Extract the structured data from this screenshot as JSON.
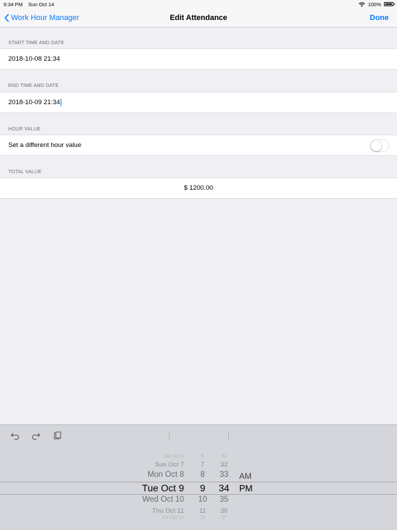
{
  "status_bar": {
    "time": "9:34 PM",
    "date": "Sun Oct 14",
    "battery": "100%"
  },
  "nav": {
    "back_label": "Work Hour Manager",
    "title": "Edit Attendance",
    "done_label": "Done"
  },
  "sections": {
    "start": {
      "header": "START TIME AND DATE",
      "value": "2018-10-08 21:34"
    },
    "end": {
      "header": "END TIME AND DATE",
      "value": "2018-10-09 21:34"
    },
    "hour": {
      "header": "HOUR VALUE",
      "label": "Set a different hour value",
      "toggle_on": false
    },
    "total": {
      "header": "TOTAL VALUE",
      "value": "$ 1200.00"
    }
  },
  "picker": {
    "dates": [
      "Sat Oct 6",
      "Sun Oct 7",
      "Mon Oct 8",
      "Tue Oct 9",
      "Wed Oct 10",
      "Thu Oct 11",
      "Fri Oct 12"
    ],
    "hours": [
      "6",
      "7",
      "8",
      "9",
      "10",
      "11",
      "12"
    ],
    "minutes": [
      "31",
      "32",
      "33",
      "34",
      "35",
      "36",
      "37"
    ],
    "ampm": [
      "AM",
      "PM"
    ]
  }
}
